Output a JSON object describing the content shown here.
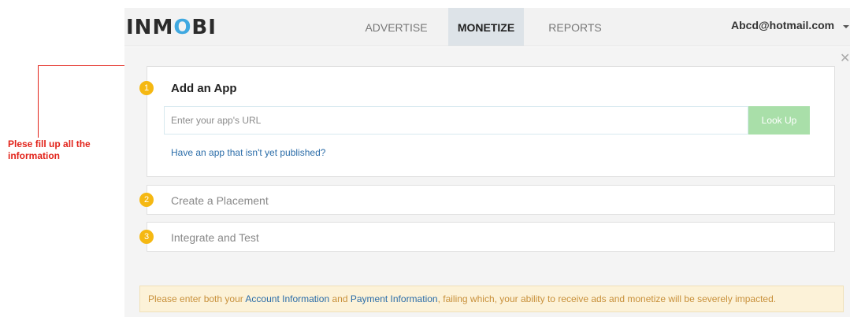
{
  "annotation": {
    "text": "Plese fill up all the information"
  },
  "header": {
    "logo": "INMOBI",
    "tabs": [
      {
        "label": "ADVERTISE",
        "active": false
      },
      {
        "label": "MONETIZE",
        "active": true
      },
      {
        "label": "REPORTS",
        "active": false
      }
    ],
    "user_email": "Abcd@hotmail.com"
  },
  "steps": [
    {
      "number": "1",
      "title": "Add an App",
      "active": true
    },
    {
      "number": "2",
      "title": "Create a Placement",
      "active": false
    },
    {
      "number": "3",
      "title": "Integrate and Test",
      "active": false
    }
  ],
  "add_app": {
    "url_placeholder": "Enter your app's URL",
    "url_value": "",
    "lookup_label": "Look Up",
    "unpublished_link": "Have an app that isn't yet published?"
  },
  "notice": {
    "prefix": "Please enter both your ",
    "account_link": "Account Information",
    "middle": " and ",
    "payment_link": "Payment Information",
    "suffix": ", failing which, your ability to receive ads and monetize will be severely impacted."
  },
  "colors": {
    "step_badge": "#f5b812",
    "annotation": "#e2231a",
    "link": "#2a6ca8",
    "lookup_button": "#a9dfa9"
  }
}
